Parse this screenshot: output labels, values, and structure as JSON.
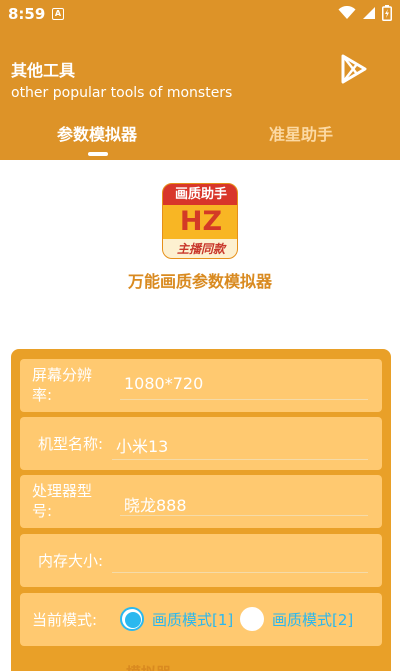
{
  "status_bar": {
    "time": "8:59",
    "notification_badge": "A"
  },
  "header": {
    "title": "其他工具",
    "subtitle": "other popular tools of monsters",
    "tabs": [
      {
        "label": "参数模拟器",
        "selected": true
      },
      {
        "label": "准星助手",
        "selected": false
      }
    ]
  },
  "app": {
    "logo": {
      "top_text": "画质助手",
      "mid_text": "HZ",
      "bottom_text": "主播同款"
    },
    "name": "万能画质参数模拟器"
  },
  "form": {
    "resolution": {
      "label": "屏幕分辨率:",
      "value": "1080*720"
    },
    "model": {
      "label": "机型名称:",
      "value": "小米13"
    },
    "processor": {
      "label": "处理器型号:",
      "value": "晓龙888"
    },
    "memory": {
      "label": "内存大小:",
      "value": ""
    },
    "mode": {
      "label": "当前模式:",
      "options": [
        {
          "label": "画质模式[1]",
          "selected": true
        },
        {
          "label": "画质模式[2]",
          "selected": false
        }
      ]
    }
  },
  "bottom": {
    "peek_label": "模拟器"
  },
  "colors": {
    "primary": "#dd9328",
    "card": "#e9a028",
    "row": "#ffc970",
    "accent": "#2ab8ef"
  }
}
